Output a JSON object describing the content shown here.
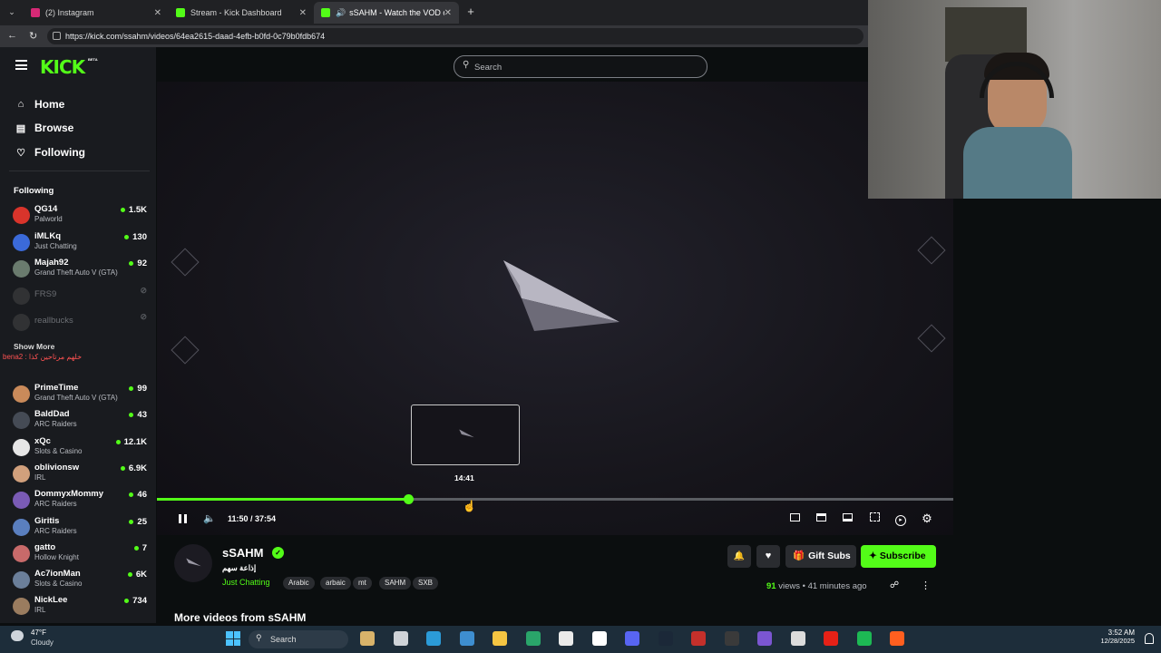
{
  "browser": {
    "tabs": [
      {
        "label": "(2) Instagram",
        "color": "#d62976"
      },
      {
        "label": "Stream - Kick Dashboard",
        "color": "#53fc18"
      },
      {
        "label": "sSAHM - Watch the VOD on K",
        "color": "#53fc18"
      }
    ],
    "url": "https://kick.com/ssahm/videos/64ea2615-daad-4efb-b0fd-0c79b0fdb674"
  },
  "site": {
    "logo": "KICK",
    "logo_badge": "BETA",
    "search_placeholder": "Search",
    "nav": [
      {
        "label": "Home",
        "icon": "home-icon"
      },
      {
        "label": "Browse",
        "icon": "browse-icon"
      },
      {
        "label": "Following",
        "icon": "heart-icon"
      }
    ],
    "following_header": "Following",
    "show_more": "Show More",
    "channels_top": [
      {
        "name": "QG14",
        "game": "Palworld",
        "viewers": "1.5K",
        "color": "#d9342b"
      },
      {
        "name": "iMLKq",
        "game": "Just Chatting",
        "viewers": "130",
        "color": "#3b6ad9"
      },
      {
        "name": "Majah92",
        "game": "Grand Theft Auto V (GTA)",
        "viewers": "92",
        "color": "#6a7b6e"
      },
      {
        "name": "FRS9",
        "game": "",
        "viewers": "",
        "color": "#555"
      },
      {
        "name": "reallbucks",
        "game": "",
        "viewers": "",
        "color": "#555"
      }
    ],
    "channels_bottom": [
      {
        "name": "PrimeTime",
        "game": "Grand Theft Auto V (GTA)",
        "viewers": "99",
        "color": "#c98a5a"
      },
      {
        "name": "BaldDad",
        "game": "ARC Raiders",
        "viewers": "43",
        "color": "#454b55"
      },
      {
        "name": "xQc",
        "game": "Slots & Casino",
        "viewers": "12.1K",
        "color": "#e6e6e6"
      },
      {
        "name": "oblivionsw",
        "game": "IRL",
        "viewers": "6.9K",
        "color": "#d1a07c"
      },
      {
        "name": "DommyxMommy",
        "game": "ARC Raiders",
        "viewers": "46",
        "color": "#7a5bb5"
      },
      {
        "name": "Giritis",
        "game": "ARC Raiders",
        "viewers": "25",
        "color": "#5a7fbf"
      },
      {
        "name": "gatto",
        "game": "Hollow Knight",
        "viewers": "7",
        "color": "#c86a6a"
      },
      {
        "name": "Ac7ionMan",
        "game": "Slots & Casino",
        "viewers": "6K",
        "color": "#6b7f9a"
      },
      {
        "name": "NickLee",
        "game": "IRL",
        "viewers": "734",
        "color": "#9a7c5f"
      }
    ],
    "chat_overlay": "bena2 : خلهم مرتاحين كذا"
  },
  "player": {
    "hover_time": "14:41",
    "time": "11:50 / 37:54",
    "progress": 0.3155
  },
  "stream": {
    "channel": "sSAHM",
    "subtitle": "إذاعة سهم",
    "category": "Just Chatting",
    "tags": [
      "Arabic",
      "arbaic",
      "mt",
      "SAHM",
      "SXB"
    ],
    "views": "91",
    "views_label": "views",
    "ago": "41 minutes ago",
    "gift_label": "Gift Subs",
    "subscribe_label": "Subscribe",
    "more_videos": "More videos from sSAHM"
  },
  "taskbar": {
    "weather_temp": "47°F",
    "weather_desc": "Cloudy",
    "search": "Search",
    "time": "3:52 AM",
    "date": "12/28/2025"
  },
  "colors": {
    "accent": "#53fc18",
    "bg": "#0b0e0f",
    "sidebar": "#191b1f"
  }
}
